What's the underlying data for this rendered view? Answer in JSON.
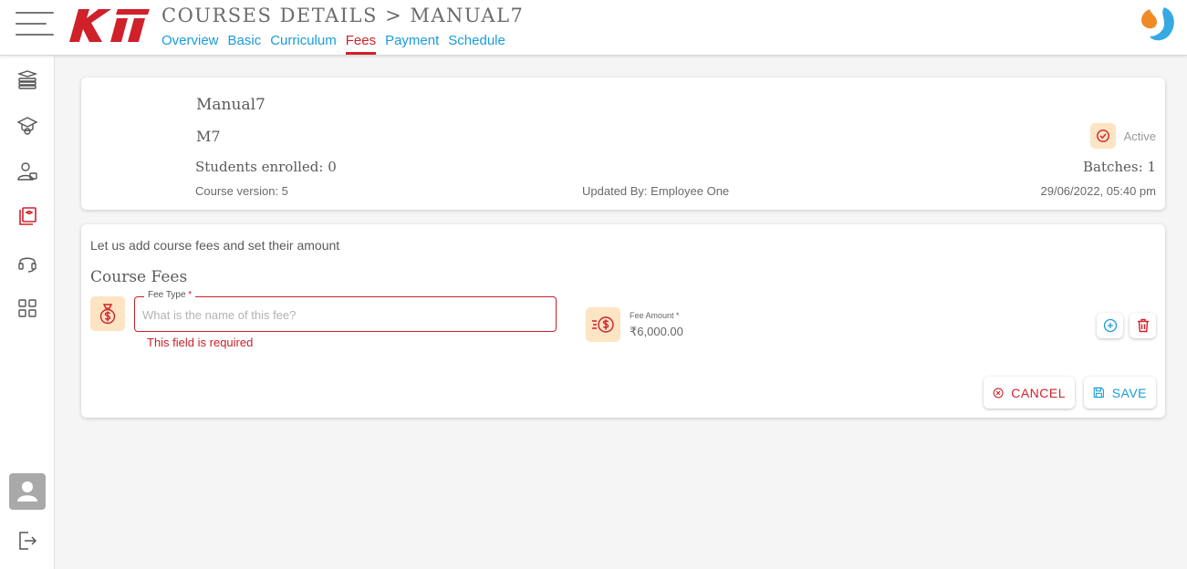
{
  "header": {
    "title": "COURSES DETAILS > MANUAL7",
    "logo_text": "Kii",
    "tabs": [
      {
        "label": "Overview",
        "active": false
      },
      {
        "label": "Basic",
        "active": false
      },
      {
        "label": "Curriculum",
        "active": false
      },
      {
        "label": "Fees",
        "active": true
      },
      {
        "label": "Payment",
        "active": false
      },
      {
        "label": "Schedule",
        "active": false
      }
    ]
  },
  "colors": {
    "accent_red": "#d0202a",
    "link_blue": "#1a9bd8",
    "icon_bg": "#fde4c2",
    "sidebar_active": "#d0202a"
  },
  "sidebar": {
    "items": [
      {
        "icon": "books-icon",
        "active": false
      },
      {
        "icon": "graduate-icon",
        "active": false
      },
      {
        "icon": "user-teacher-icon",
        "active": false
      },
      {
        "icon": "course-book-icon",
        "active": true
      },
      {
        "icon": "headset-icon",
        "active": false
      },
      {
        "icon": "grid-icon",
        "active": false
      }
    ],
    "bottom": [
      "avatar-icon",
      "logout-icon"
    ]
  },
  "course": {
    "name": "Manual7",
    "code": "M7",
    "students_enrolled": "Students enrolled: 0",
    "version": "Course version: 5",
    "updated_by": "Updated By: Employee One",
    "updated_at": "29/06/2022, 05:40 pm",
    "batches": "Batches: 1",
    "status": "Active"
  },
  "fees": {
    "intro": "Let us add course fees and set their amount",
    "section_title": "Course Fees",
    "fee_type_label": "Fee Type",
    "required_mark": "*",
    "fee_type_value": "",
    "fee_type_placeholder": "What is the name of this fee?",
    "fee_type_error": "This field is required",
    "fee_amount_label": "Fee Amount *",
    "fee_amount_value": "₹6,000.00",
    "cancel_label": "CANCEL",
    "save_label": "SAVE"
  }
}
